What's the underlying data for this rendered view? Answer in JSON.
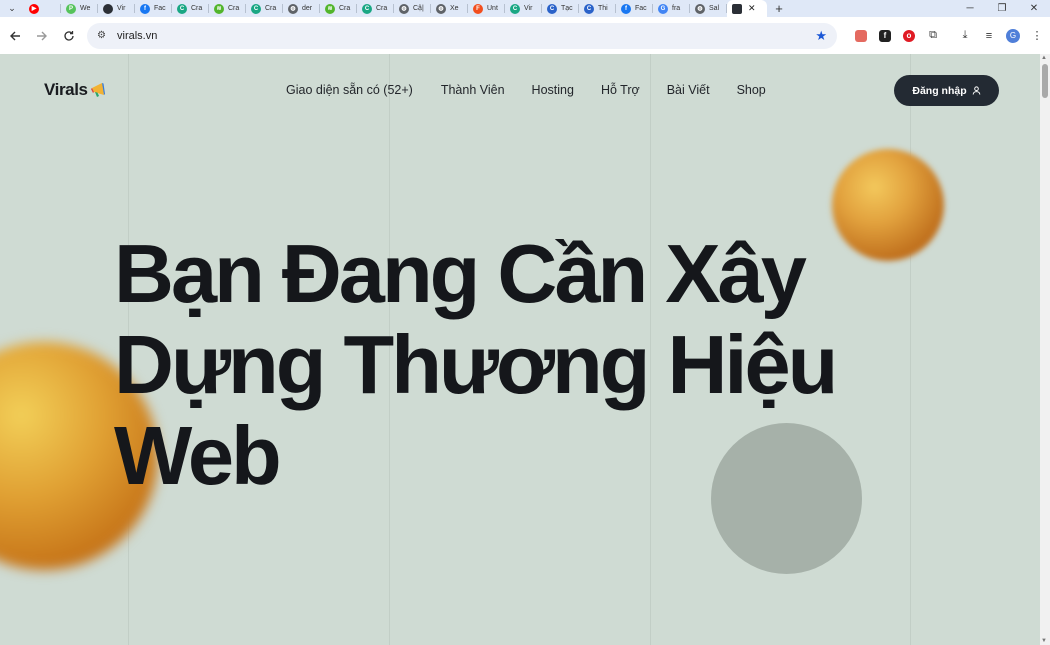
{
  "browser": {
    "tabs": [
      {
        "icon": "youtube-icon",
        "label": "",
        "color": "#ff0000"
      },
      {
        "icon": "p-app-icon",
        "label": "We",
        "color": "#56c35b"
      },
      {
        "icon": "virals-icon",
        "label": "Vir",
        "color": "#2b2f36"
      },
      {
        "icon": "facebook-icon",
        "label": "Fac",
        "color": "#1877f2"
      },
      {
        "icon": "circle-c-icon",
        "label": "Cra",
        "color": "#1aa784"
      },
      {
        "icon": "leaf-icon",
        "label": "Cra",
        "color": "#52b52c"
      },
      {
        "icon": "circle-c-icon",
        "label": "Cra",
        "color": "#1aa784"
      },
      {
        "icon": "globe-icon",
        "label": "der",
        "color": "#5f6368"
      },
      {
        "icon": "leaf-icon",
        "label": "Cra",
        "color": "#52b52c"
      },
      {
        "icon": "circle-c-icon",
        "label": "Cra",
        "color": "#1aa784"
      },
      {
        "icon": "globe-icon",
        "label": "Cậ|",
        "color": "#5f6368"
      },
      {
        "icon": "globe-icon",
        "label": "Xe",
        "color": "#5f6368"
      },
      {
        "icon": "figma-icon",
        "label": "Unt",
        "color": "#f24e1e"
      },
      {
        "icon": "circle-c-icon",
        "label": "Vir",
        "color": "#1aa784"
      },
      {
        "icon": "circle-c-icon",
        "label": "Tạc",
        "color": "#2a62c9"
      },
      {
        "icon": "circle-c-icon",
        "label": "Thi",
        "color": "#2a62c9"
      },
      {
        "icon": "facebook-icon",
        "label": "Fac",
        "color": "#1877f2"
      },
      {
        "icon": "google-icon",
        "label": "fra",
        "color": "#4285f4"
      },
      {
        "icon": "globe-icon",
        "label": "Sal",
        "color": "#5f6368"
      }
    ],
    "active_tab": {
      "icon": "virals-icon",
      "label": "",
      "close": "✕"
    },
    "new_tab": "+",
    "window": {
      "minimize": "─",
      "restore": "❐",
      "close": "✕"
    },
    "url": "virals.vn"
  },
  "site": {
    "logo_text": "Virals",
    "nav": [
      "Giao diện sẵn có (52+)",
      "Thành Viên",
      "Hosting",
      "Hỗ Trợ",
      "Bài Viết",
      "Shop"
    ],
    "login_label": "Đăng nhập",
    "hero_lines": [
      "Bạn Đang Cần Xây",
      "Dựng Thương Hiệu",
      "Web"
    ],
    "colors": {
      "background": "#cfdbd3",
      "button": "#232a33",
      "text": "#15171b",
      "orb": "#d8902e",
      "circle": "#a6b1a9"
    }
  }
}
